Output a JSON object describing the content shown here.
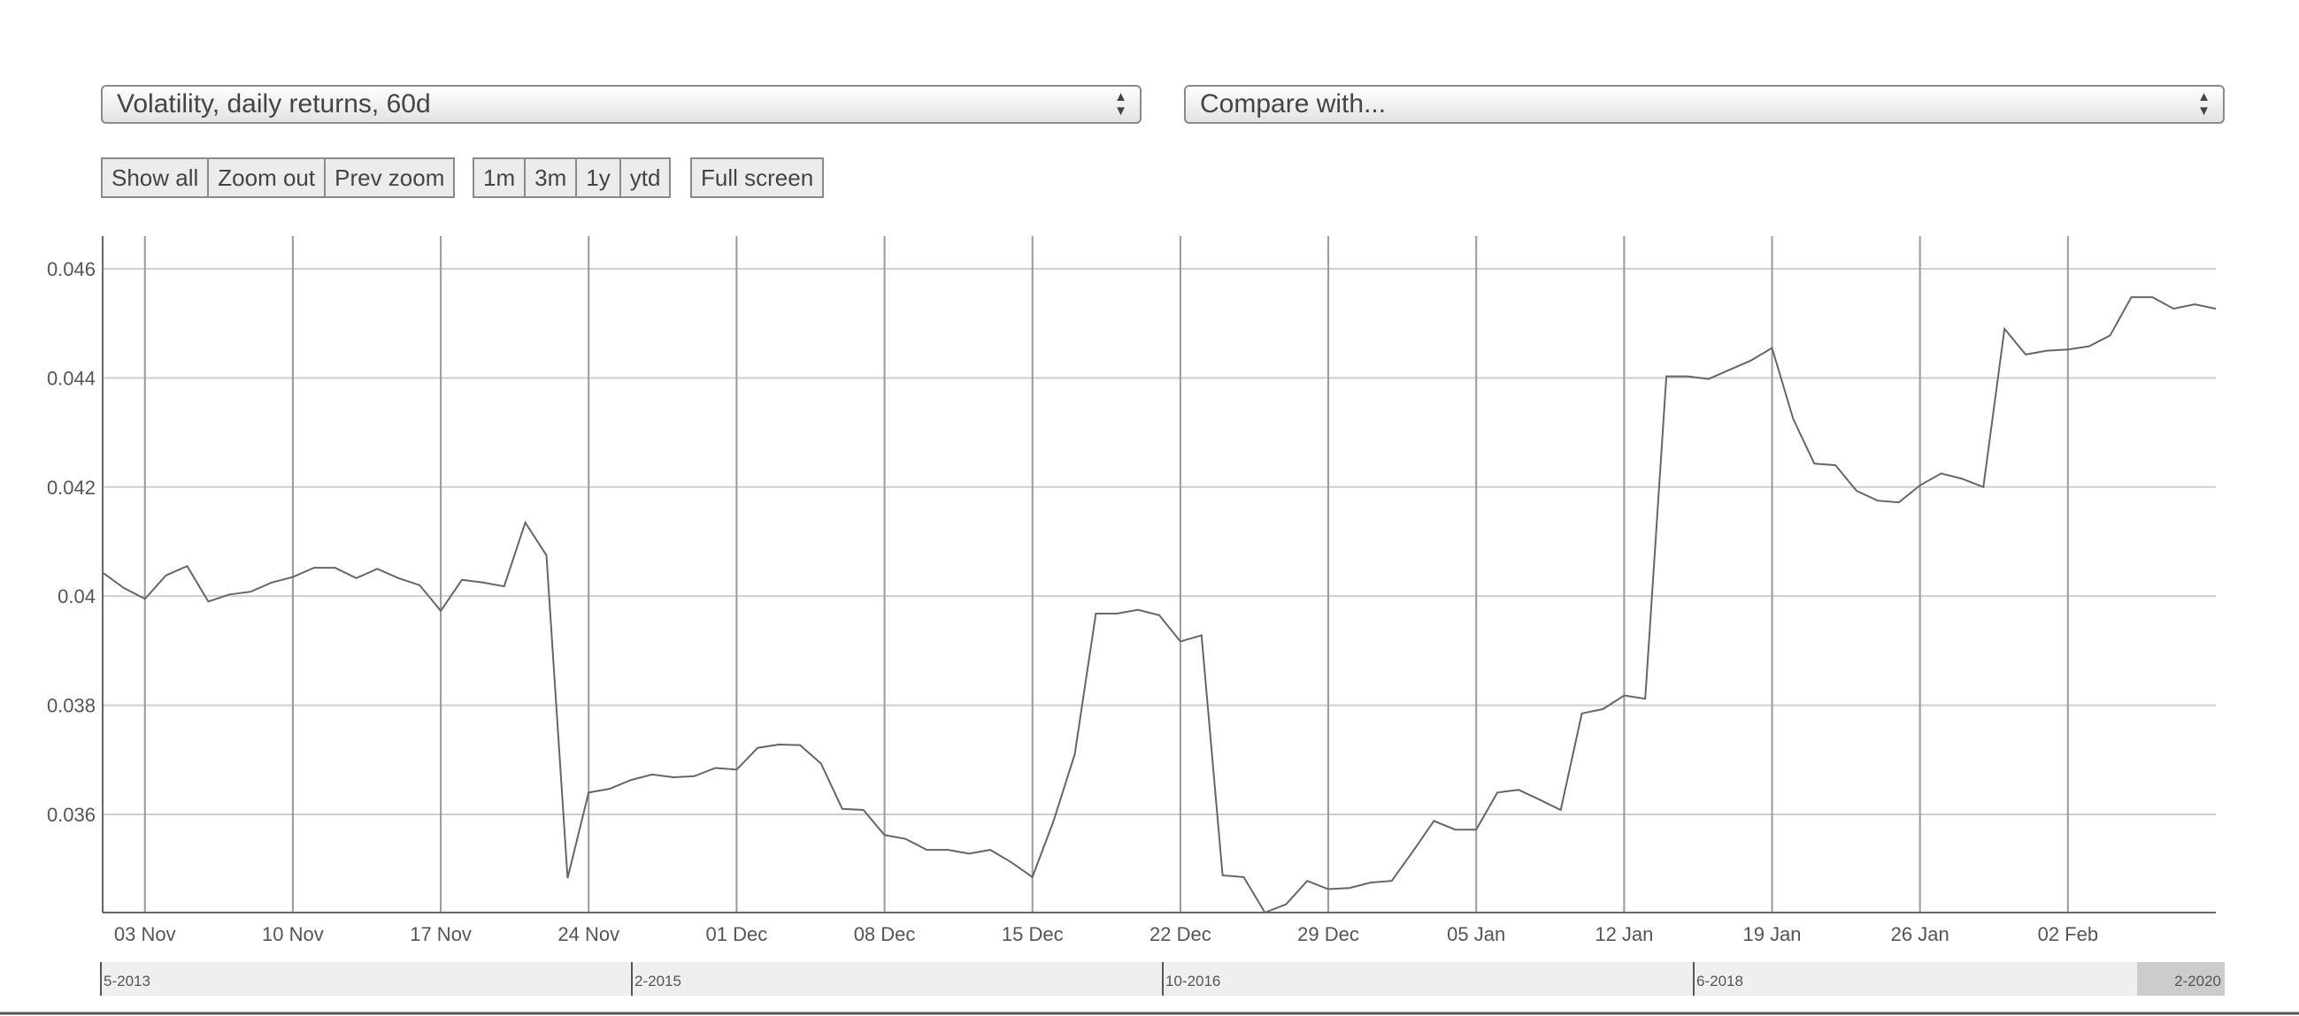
{
  "controls": {
    "metric_select": "Volatility, daily returns, 60d",
    "compare_select": "Compare with...",
    "zoom_buttons": [
      "Show all",
      "Zoom out",
      "Prev zoom"
    ],
    "range_buttons": [
      "1m",
      "3m",
      "1y",
      "ytd"
    ],
    "fullscreen_button": "Full screen"
  },
  "navigator": {
    "labels": [
      "5-2013",
      "2-2015",
      "10-2016",
      "6-2018",
      "2-2020"
    ]
  },
  "colors": {
    "line": "#666666",
    "grid": "#cfcfcf",
    "navigator_bg": "#efefef",
    "navigator_selected": "#cccccc"
  },
  "chart_data": {
    "type": "line",
    "title": "",
    "xlabel": "",
    "ylabel": "",
    "x_tick_labels": [
      "03 Nov",
      "10 Nov",
      "17 Nov",
      "24 Nov",
      "01 Dec",
      "08 Dec",
      "15 Dec",
      "22 Dec",
      "29 Dec",
      "05 Jan",
      "12 Jan",
      "19 Jan",
      "26 Jan",
      "02 Feb"
    ],
    "y_tick_labels": [
      "0.046",
      "0.044",
      "0.042",
      "0.04",
      "0.038",
      "0.036"
    ],
    "ylim": [
      0.0342,
      0.0466
    ],
    "grid": true,
    "series": [
      {
        "values": [
          0.04043,
          0.04015,
          0.03995,
          0.04038,
          0.04055,
          0.0399,
          0.04003,
          0.04008,
          0.04025,
          0.04035,
          0.04052,
          0.04052,
          0.04033,
          0.0405,
          0.04033,
          0.0402,
          0.03973,
          0.0403,
          0.04025,
          0.04018,
          0.04135,
          0.04075,
          0.03483,
          0.0364,
          0.03647,
          0.03663,
          0.03673,
          0.03668,
          0.0367,
          0.03685,
          0.03682,
          0.03722,
          0.03728,
          0.03727,
          0.03693,
          0.0361,
          0.03608,
          0.03562,
          0.03555,
          0.03535,
          0.03535,
          0.03528,
          0.03535,
          0.03512,
          0.03485,
          0.03588,
          0.0371,
          0.03968,
          0.03968,
          0.03975,
          0.03965,
          0.03917,
          0.03928,
          0.03488,
          0.03485,
          0.0342,
          0.03435,
          0.03478,
          0.03463,
          0.03465,
          0.03475,
          0.03478,
          0.03532,
          0.03588,
          0.03572,
          0.03572,
          0.0364,
          0.03645,
          0.03627,
          0.03608,
          0.03785,
          0.03793,
          0.03818,
          0.03812,
          0.04403,
          0.04403,
          0.04398,
          0.04415,
          0.04432,
          0.04455,
          0.04325,
          0.04243,
          0.0424,
          0.04193,
          0.04175,
          0.04172,
          0.04203,
          0.04225,
          0.04215,
          0.042,
          0.0449,
          0.04443,
          0.0445,
          0.04452,
          0.04458,
          0.04478,
          0.04548,
          0.04548,
          0.04527,
          0.04535,
          0.04527
        ]
      }
    ]
  }
}
